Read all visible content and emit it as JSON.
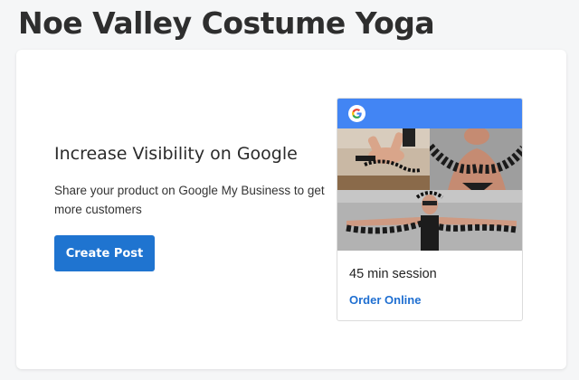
{
  "page": {
    "title": "Noe Valley Costume Yoga"
  },
  "promo": {
    "heading": "Increase Visibility on Google",
    "description": "Share your product on Google My Business to get more customers",
    "button_label": "Create Post"
  },
  "preview": {
    "header_icon": "google-g-icon",
    "title": "45 min session",
    "link_label": "Order Online"
  },
  "colors": {
    "brand_blue": "#1f74d0",
    "google_header": "#4285f4",
    "link": "#1f6fd1"
  }
}
